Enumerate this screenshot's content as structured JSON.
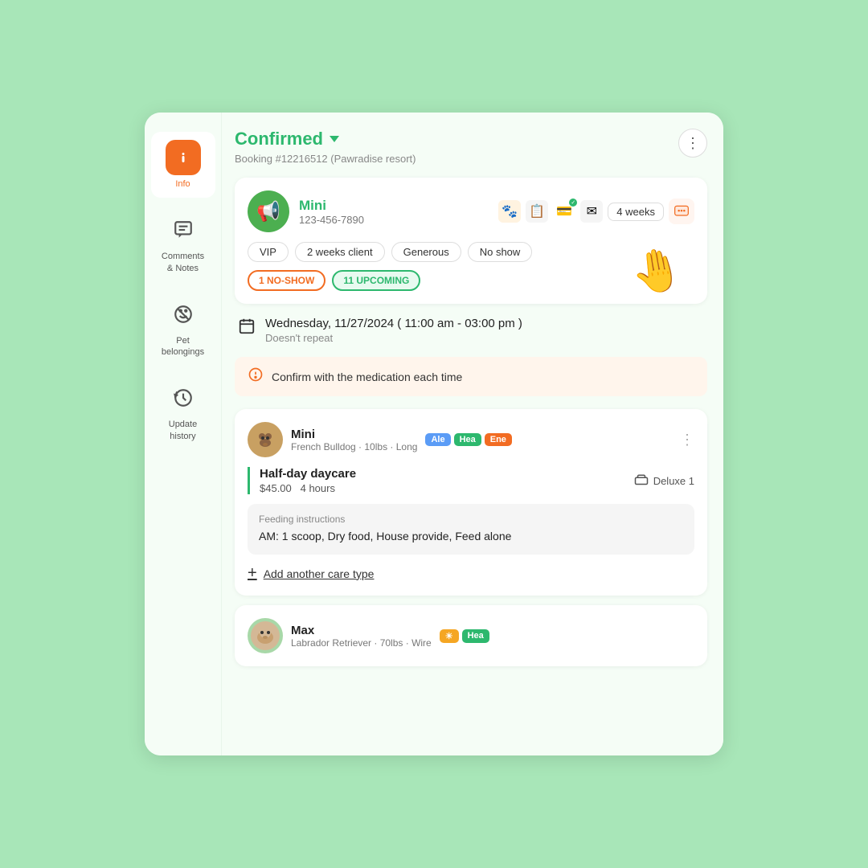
{
  "sidebar": {
    "items": [
      {
        "id": "info",
        "label": "Info",
        "icon": "ℹ",
        "active": true
      },
      {
        "id": "comments",
        "label": "Comments\n& Notes",
        "icon": "📋",
        "active": false
      },
      {
        "id": "pet-belongings",
        "label": "Pet\nbelongings",
        "icon": "🚫",
        "active": false
      },
      {
        "id": "update-history",
        "label": "Update\nhistory",
        "icon": "🕐",
        "active": false
      }
    ]
  },
  "booking": {
    "status": "Confirmed",
    "id": "Booking #12216512",
    "location": "Pawradise resort",
    "more_button_label": "⋮"
  },
  "pet_owner": {
    "name": "Mini",
    "phone": "123-456-7890",
    "avatar_emoji": "📢",
    "icons": [
      "🐾",
      "📋",
      "💳",
      "✉"
    ],
    "weeks": "4 weeks",
    "tags": [
      "VIP",
      "2 weeks client",
      "Generous",
      "No show"
    ],
    "badge_no_show": "1 NO-SHOW",
    "badge_upcoming": "11 UPCOMING"
  },
  "appointment": {
    "date": "Wednesday, 11/27/2024  ( 11:00 am - 03:00 pm )",
    "repeat": "Doesn't repeat"
  },
  "alert": {
    "text": "Confirm with the medication each time"
  },
  "services": [
    {
      "pet_name": "Mini",
      "pet_detail": "French Bulldog · 10lbs · Long",
      "pet_avatar_emoji": "🐶",
      "tags": [
        {
          "label": "Ale",
          "color": "blue"
        },
        {
          "label": "Hea",
          "color": "green"
        },
        {
          "label": "Ene",
          "color": "orange"
        }
      ],
      "service_name": "Half-day daycare",
      "service_price": "$45.00",
      "service_duration": "4 hours",
      "service_room": "Deluxe 1",
      "feeding_label": "Feeding instructions",
      "feeding_text": "AM: 1 scoop, Dry food, House provide, Feed alone",
      "add_care_label": "Add another care type"
    }
  ],
  "second_pet": {
    "name": "Max",
    "detail": "Labrador Retriever · 70lbs · Wire",
    "tags": [
      {
        "label": "☀",
        "color": "yellow"
      },
      {
        "label": "Hea",
        "color": "green"
      }
    ]
  }
}
